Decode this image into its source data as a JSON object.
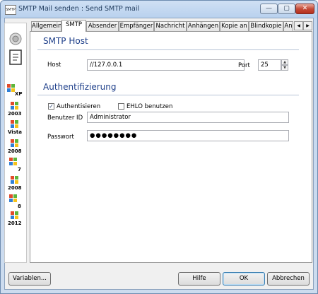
{
  "window": {
    "title": "SMTP Mail senden : Send SMTP mail",
    "app_icon_text": "SMTP",
    "minimize_glyph": "—",
    "maximize_glyph": "▢",
    "close_glyph": "✕"
  },
  "sidebar": {
    "items": [
      {
        "icon": "circle-icon"
      },
      {
        "icon": "document-icon"
      },
      {
        "label": "XP"
      },
      {
        "label": "2003"
      },
      {
        "label": "Vista"
      },
      {
        "label": "2008"
      },
      {
        "label": "7"
      },
      {
        "label": "2008"
      },
      {
        "label": "8"
      },
      {
        "label": "2012"
      }
    ]
  },
  "tabs": {
    "items": [
      "Allgemein",
      "SMTP",
      "Absender",
      "Empfänger",
      "Nachricht",
      "Anhängen",
      "Kopie an",
      "Blindkopie",
      "An"
    ],
    "active": "SMTP",
    "scroll_left": "◀",
    "scroll_right": "▶"
  },
  "smtp_host": {
    "heading": "SMTP Host",
    "host_label": "Host",
    "host_value": "//127.0.0.1",
    "port_label": "Port",
    "port_value": "25"
  },
  "auth": {
    "heading": "Authentifizierung",
    "authenticate_label": "Authentisieren",
    "authenticate_checked": true,
    "ehlo_label": "EHLO benutzen",
    "ehlo_checked": false,
    "user_label": "Benutzer ID",
    "user_value": "Administrator",
    "password_label": "Passwort",
    "password_value": "●●●●●●●●"
  },
  "footer": {
    "variables_button": "Variablen...",
    "help_button": "Hilfe",
    "ok_button": "OK",
    "cancel_button": "Abbrechen"
  },
  "colors": {
    "heading": "#1e3f8a",
    "flag_red": "#e24a2a",
    "flag_green": "#5db53a",
    "flag_blue": "#2f7fd6",
    "flag_yellow": "#f5c21a"
  }
}
